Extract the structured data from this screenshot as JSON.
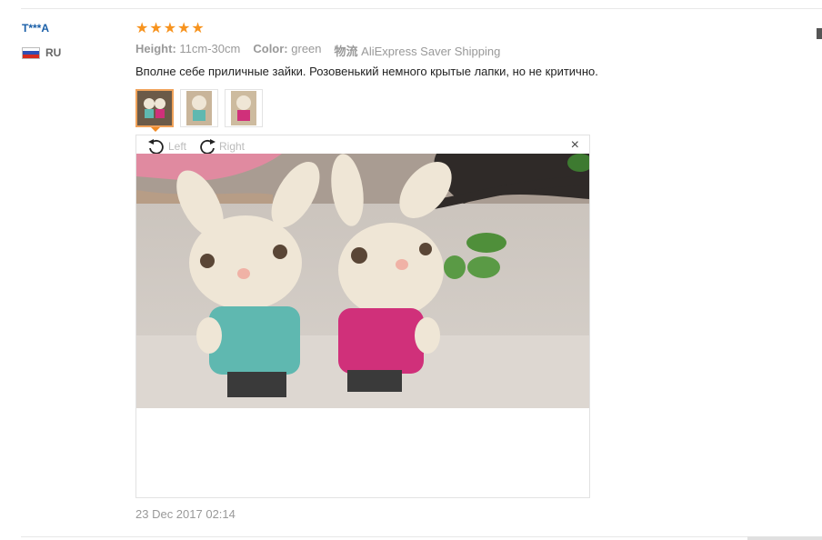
{
  "review": {
    "user": "T***A",
    "country_code": "RU",
    "rating": 5,
    "star_glyph": "★",
    "attributes": [
      {
        "label": "Height:",
        "value": "11cm-30cm"
      },
      {
        "label": "Color:",
        "value": "green"
      },
      {
        "label": "物流",
        "value": "AliExpress Saver Shipping"
      }
    ],
    "text": "Вполне себе приличные зайки. Розовенький немного крытые лапки, но не критично.",
    "date": "23 Dec 2017 02:14"
  },
  "viewer": {
    "rotate_left_label": "Left",
    "rotate_right_label": "Right",
    "close_label": "×"
  },
  "colors": {
    "accent": "#f7931e",
    "username": "#1a5fa8"
  },
  "icons": {
    "rotate_left": "rotate-left-icon",
    "rotate_right": "rotate-right-icon",
    "close": "close-icon",
    "flag": "russia-flag-icon"
  }
}
